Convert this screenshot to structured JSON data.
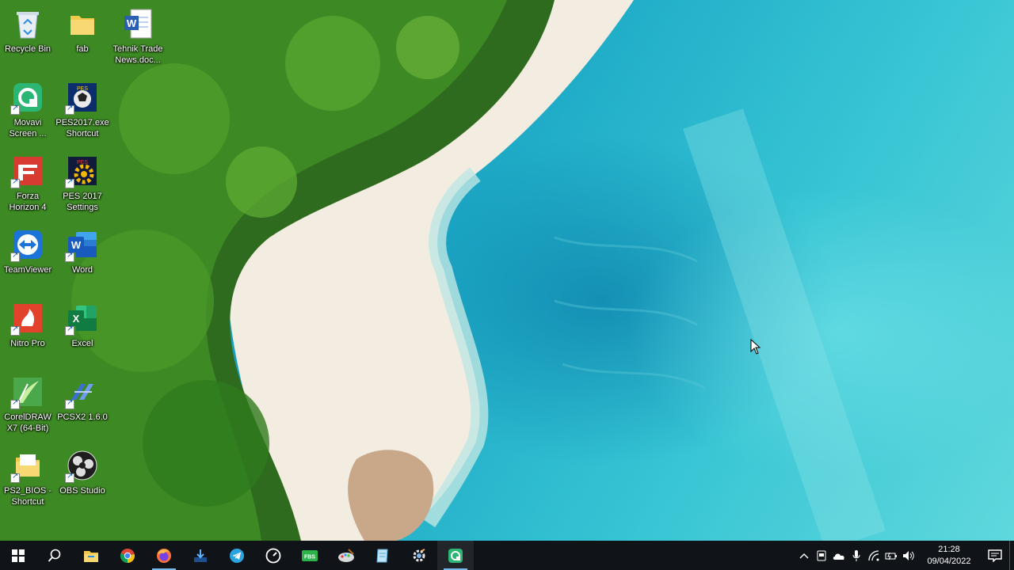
{
  "desktop": {
    "icons": [
      {
        "label": "Recycle Bin",
        "icon": "recycle-bin-icon"
      },
      {
        "label": "fab",
        "icon": "folder-icon"
      },
      {
        "label": "Tehnik Trade\nNews.doc...",
        "icon": "word-document-icon"
      },
      {
        "label": "Movavi\nScreen ...",
        "icon": "movavi-icon"
      },
      {
        "label": "PES2017.exe\nShortcut",
        "icon": "pes2017-icon"
      },
      {
        "label": "Forza\nHorizon 4",
        "icon": "forza-icon"
      },
      {
        "label": "PES 2017\nSettings",
        "icon": "pes-settings-icon"
      },
      {
        "label": "TeamViewer",
        "icon": "teamviewer-icon"
      },
      {
        "label": "Word",
        "icon": "word-icon"
      },
      {
        "label": "Nitro Pro",
        "icon": "nitro-icon"
      },
      {
        "label": "Excel",
        "icon": "excel-icon"
      },
      {
        "label": "CorelDRAW\nX7 (64-Bit)",
        "icon": "coreldraw-icon"
      },
      {
        "label": "PCSX2 1.6.0",
        "icon": "pcsx2-icon"
      },
      {
        "label": "PS2_BIOS -\nShortcut",
        "icon": "folder-shortcut-icon"
      },
      {
        "label": "OBS Studio",
        "icon": "obs-icon"
      }
    ]
  },
  "taskbar": {
    "apps": [
      "start-icon",
      "search-icon",
      "file-explorer-icon",
      "chrome-icon",
      "firefox-icon",
      "downloader-icon",
      "telegram-icon",
      "speedometer-icon",
      "fbs-icon",
      "paint-icon",
      "notepad-icon",
      "settings-gear-icon",
      "movavi-icon"
    ],
    "clock": {
      "time": "21:28",
      "date": "09/04/2022"
    },
    "colors": {
      "taskbar_bg": "#101418",
      "running_indicator": "#76b9ed"
    }
  }
}
